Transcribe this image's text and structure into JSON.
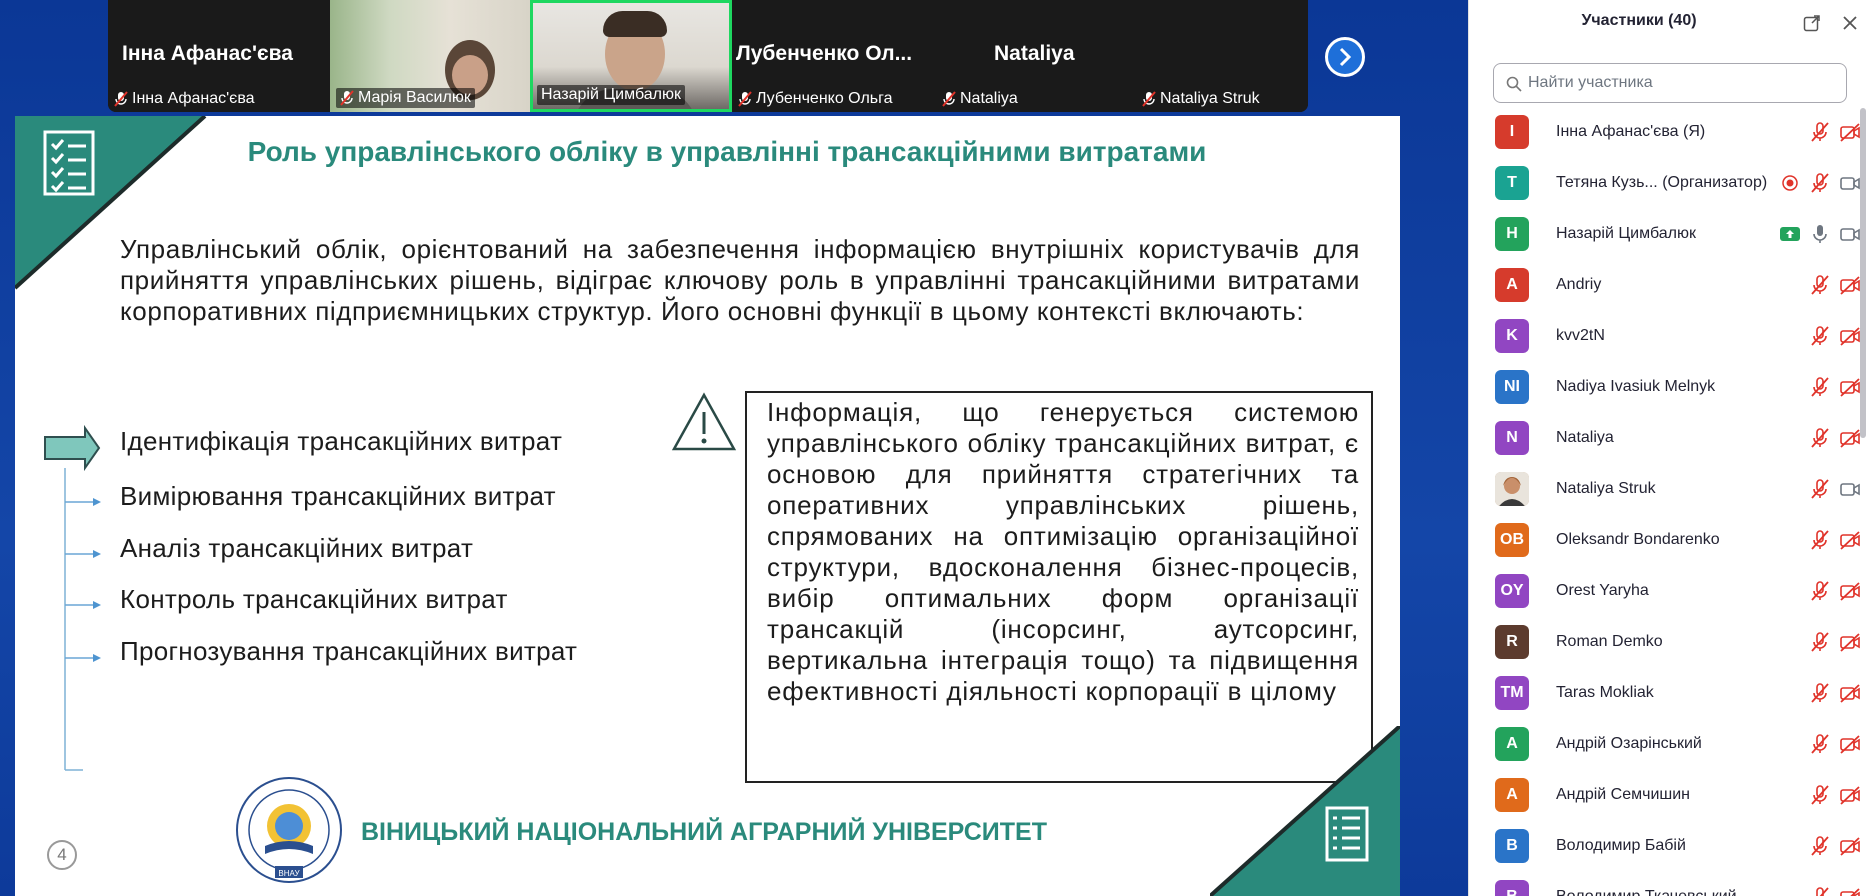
{
  "video_strip": {
    "tiles": [
      {
        "big_name": "Інна Афанас'єва",
        "label": "Інна Афанас'єва"
      },
      {
        "big_name": "",
        "label": "Марія Василюк"
      },
      {
        "big_name": "",
        "label": "Назарій Цимбалюк"
      },
      {
        "big_name": "Лубенченко  Ол...",
        "label": "Лубенченко Ольга"
      },
      {
        "big_name": "Nataliya",
        "label": "Nataliya"
      },
      {
        "big_name": "",
        "label": "Nataliya Struk"
      }
    ]
  },
  "slide": {
    "title": "Роль управлінського обліку в управлінні трансакційними витратами",
    "intro": "Управлінський облік, орієнтований на забезпечення інформацією внутрішніх користувачів для прийняття управлінських рішень, відіграє ключову роль в управлінні трансакційними витратами корпоративних підприємницьких структур. Його основні функції в цьому контексті включають:",
    "functions": [
      "Ідентифікація трансакційних витрат",
      "Вимірювання трансакційних витрат",
      "Аналіз трансакційних витрат",
      "Контроль трансакційних витрат",
      "Прогнозування трансакційних витрат"
    ],
    "info_box": "Інформація, що генерується системою управлінського обліку трансакційних витрат, є основою для прийняття стратегічних та оперативних управлінських рішень, спрямованих на оптимізацію організаційної структури, вдосконалення бізнес-процесів, вибір оптимальних форм організації трансакцій (інсорсинг, аутсорсинг, вертикальна інтеграція тощо) та підвищення ефективності діяльності корпорації в цілому",
    "university": "ВІНИЦЬКИЙ НАЦІОНАЛЬНИЙ АГРАРНИЙ УНІВЕРСИТЕТ",
    "logo_text": "ВНАУ",
    "page_number": "4",
    "accent_color": "#2a8a7c"
  },
  "panel": {
    "title": "Участники (40)",
    "search_placeholder": "Найти участника",
    "participants": [
      {
        "initials": "I",
        "name": "Інна Афанас'єва (Я)",
        "color": "#d63b2c",
        "mic": "muted",
        "video": "off"
      },
      {
        "initials": "T",
        "name": "Тетяна Кузь...  (Организатор)",
        "color": "#1aa392",
        "mic": "muted",
        "video": "on",
        "recording": true
      },
      {
        "initials": "H",
        "name": "Назарій Цимбалюк",
        "color": "#23a35c",
        "mic": "on",
        "video": "on",
        "sharing": true
      },
      {
        "initials": "A",
        "name": "Andriy",
        "color": "#d63b2c",
        "mic": "muted",
        "video": "off"
      },
      {
        "initials": "K",
        "name": "kvv2tN",
        "color": "#9146c2",
        "mic": "muted",
        "video": "off"
      },
      {
        "initials": "NI",
        "name": "Nadiya Ivasiuk Melnyk",
        "color": "#2a74c8",
        "mic": "muted",
        "video": "off"
      },
      {
        "initials": "N",
        "name": "Nataliya",
        "color": "#9146c2",
        "mic": "muted",
        "video": "off"
      },
      {
        "initials": "",
        "name": "Nataliya Struk",
        "color": "#c9a27e",
        "mic": "muted",
        "video": "on",
        "photo": true
      },
      {
        "initials": "OB",
        "name": "Oleksandr Bondarenko",
        "color": "#e06a1b",
        "mic": "muted",
        "video": "off"
      },
      {
        "initials": "OY",
        "name": "Orest Yaryha",
        "color": "#9146c2",
        "mic": "muted",
        "video": "off"
      },
      {
        "initials": "R",
        "name": "Roman Demko",
        "color": "#5c3b2e",
        "mic": "muted",
        "video": "off"
      },
      {
        "initials": "TM",
        "name": "Taras Mokliak",
        "color": "#9146c2",
        "mic": "muted",
        "video": "off"
      },
      {
        "initials": "A",
        "name": "Андрій Озарінський",
        "color": "#23a35c",
        "mic": "muted",
        "video": "off"
      },
      {
        "initials": "A",
        "name": "Андрій Семчишин",
        "color": "#e06a1b",
        "mic": "muted",
        "video": "off"
      },
      {
        "initials": "B",
        "name": "Володимир Бабій",
        "color": "#2a74c8",
        "mic": "muted",
        "video": "off"
      },
      {
        "initials": "B",
        "name": "Володимир Ткачевський",
        "color": "#9146c2",
        "mic": "muted",
        "video": "off"
      }
    ]
  }
}
